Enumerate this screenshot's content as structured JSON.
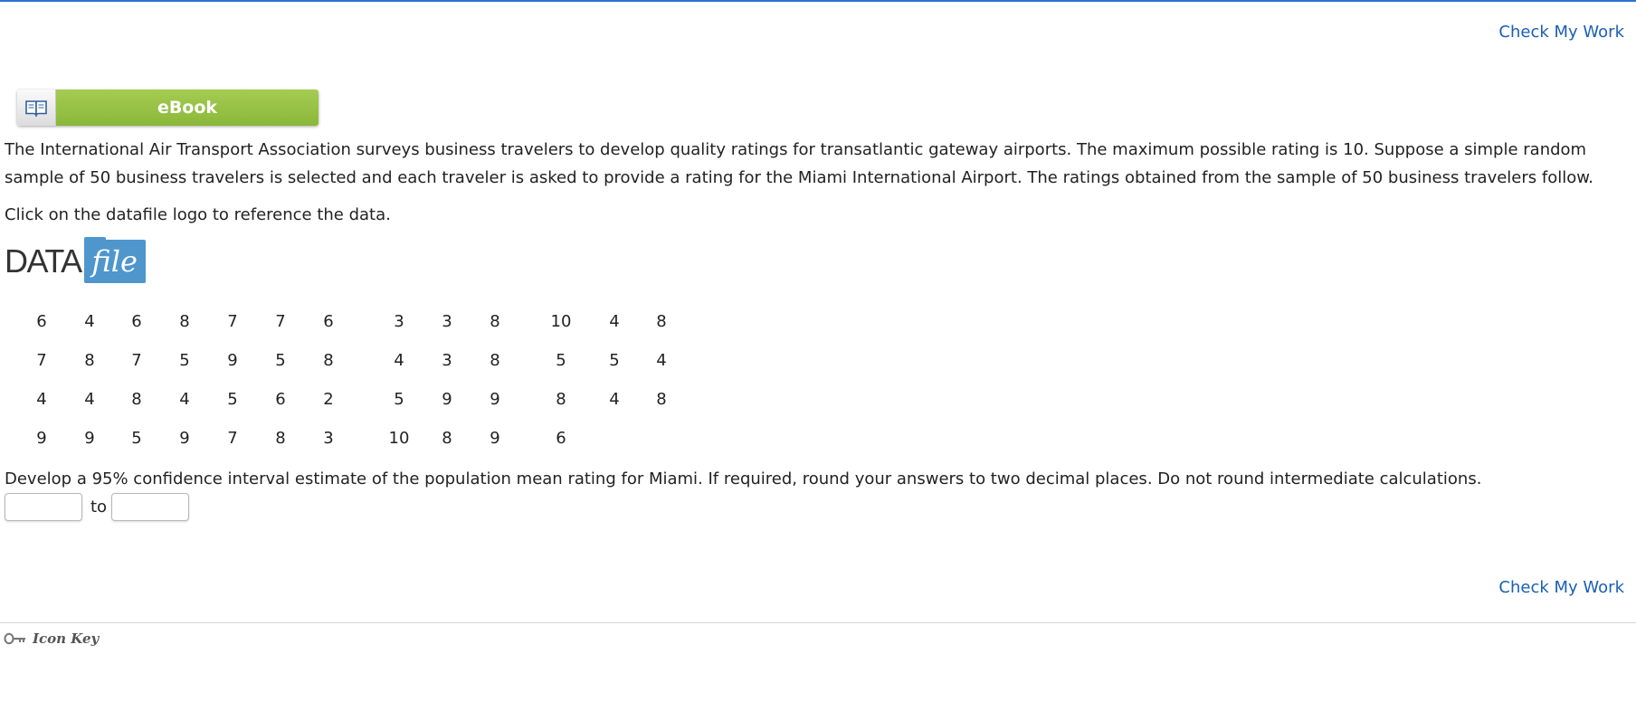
{
  "header": {
    "check_my_work_label": "Check My Work"
  },
  "ebook": {
    "label": "eBook",
    "icon": "book-icon"
  },
  "problem": {
    "intro": "The International Air Transport Association surveys business travelers to develop quality ratings for transatlantic gateway airports. The maximum possible rating is 10. Suppose a simple random sample of 50 business travelers is selected and each traveler is asked to provide a rating for the Miami International Airport. The ratings obtained from the sample of 50 business travelers follow.",
    "click_note": "Click on the datafile logo to reference the data.",
    "datafile_logo": {
      "data_text": "DATA",
      "file_text": "file",
      "color": "#4f96cd"
    },
    "ratings": [
      [
        "6",
        "4",
        "6",
        "8",
        "7",
        "7",
        "6",
        "3",
        "3",
        "8",
        "10",
        "4",
        "8"
      ],
      [
        "7",
        "8",
        "7",
        "5",
        "9",
        "5",
        "8",
        "4",
        "3",
        "8",
        "5",
        "5",
        "4"
      ],
      [
        "4",
        "4",
        "8",
        "4",
        "5",
        "6",
        "2",
        "5",
        "9",
        "9",
        "8",
        "4",
        "8"
      ],
      [
        "9",
        "9",
        "5",
        "9",
        "7",
        "8",
        "3",
        "10",
        "8",
        "9",
        "6",
        "",
        ""
      ]
    ],
    "question": "Develop a 95% confidence interval estimate of the population mean rating for Miami. If required, round your answers to two decimal places. Do not round intermediate calculations.",
    "answer": {
      "lower_value": "",
      "upper_value": "",
      "to_label": "to"
    }
  },
  "footer": {
    "check_my_work_label": "Check My Work",
    "icon_key_label": "Icon Key",
    "icon": "key-icon"
  },
  "colors": {
    "link": "#1a5fb4",
    "ebook_green": "#96c345",
    "top_border": "#2f6fd6"
  }
}
